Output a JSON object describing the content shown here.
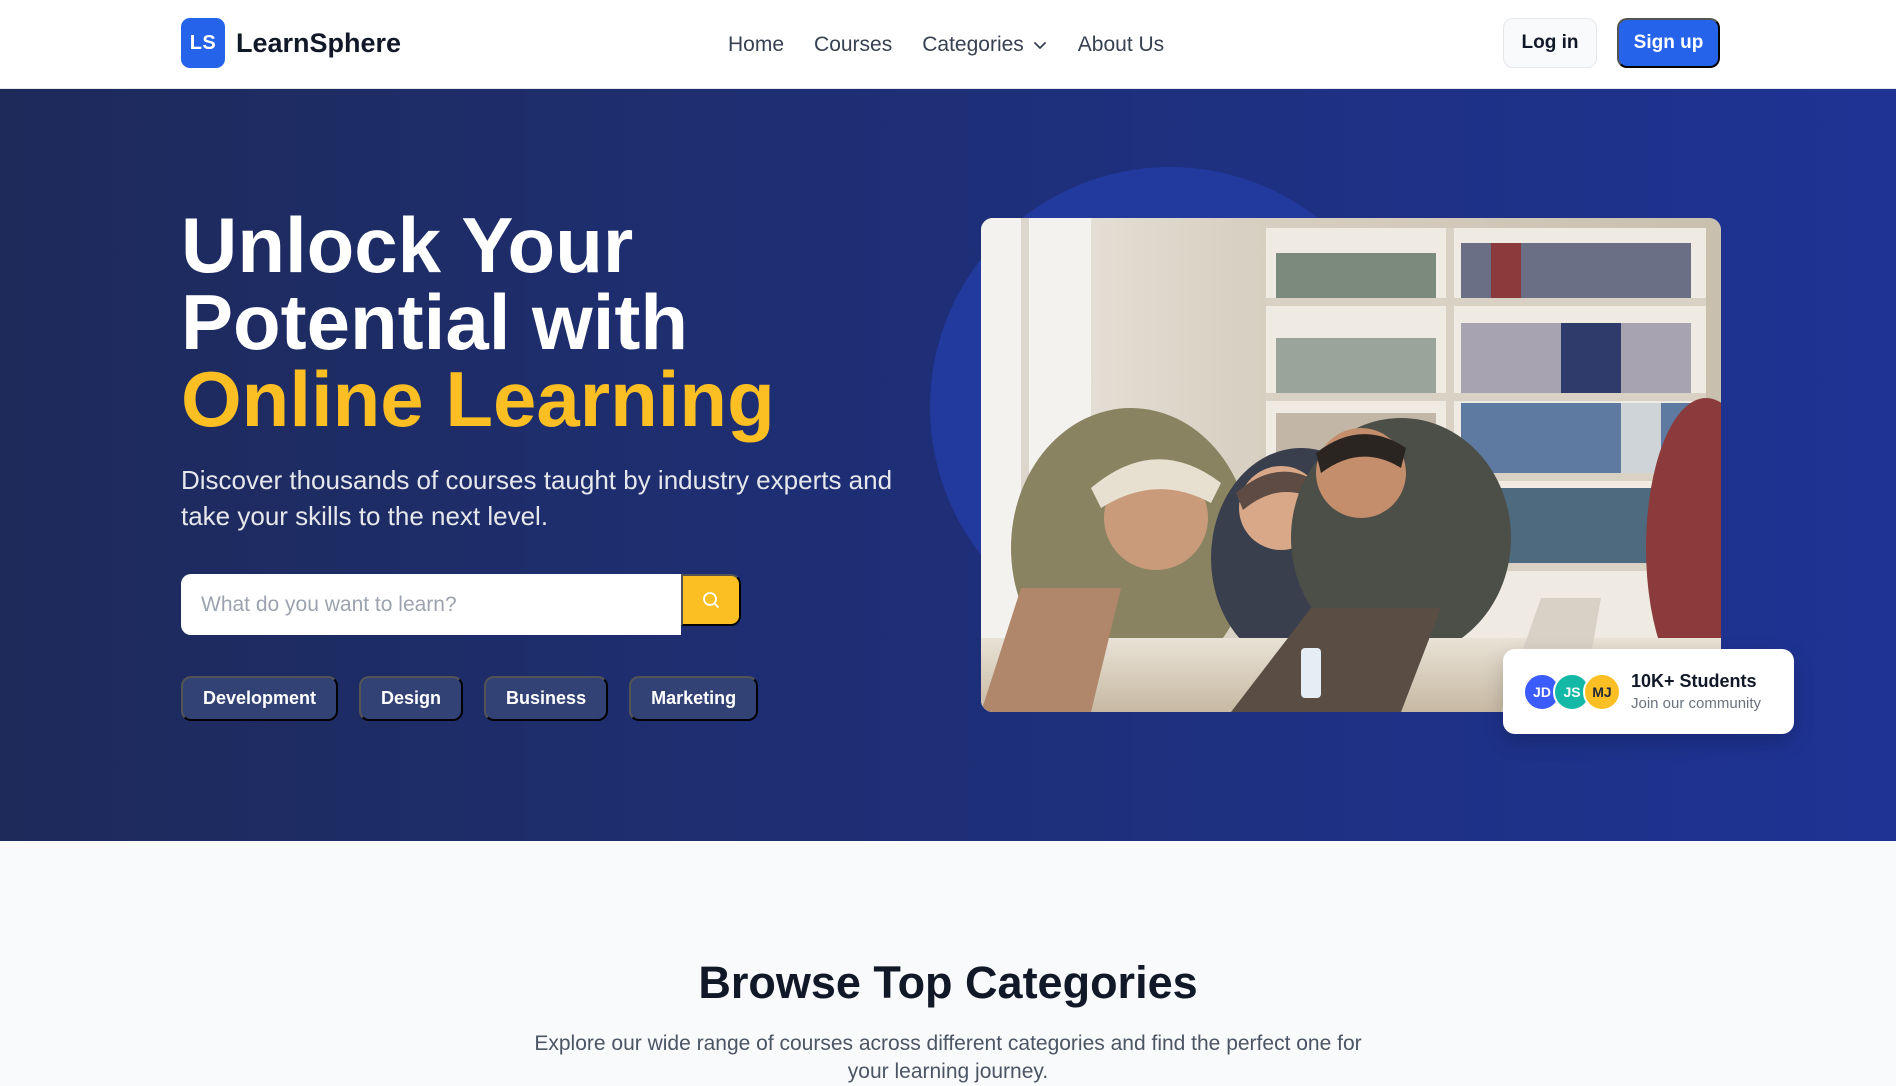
{
  "brand": {
    "logo_initials": "LS",
    "name": "LearnSphere",
    "accent_color": "#2563eb"
  },
  "nav": {
    "links": [
      {
        "label": "Home"
      },
      {
        "label": "Courses"
      },
      {
        "label": "Categories",
        "dropdown": true
      },
      {
        "label": "About Us"
      }
    ],
    "login_label": "Log in",
    "signup_label": "Sign up"
  },
  "hero": {
    "title_line1": "Unlock Your",
    "title_line2": "Potential with",
    "title_accent": "Online Learning",
    "subtitle": "Discover thousands of courses taught by industry experts and take your skills to the next level.",
    "search_placeholder": "What do you want to learn?",
    "search_icon": "search-icon",
    "chips": [
      "Development",
      "Design",
      "Business",
      "Marketing"
    ],
    "accent_color": "#fbbf24",
    "stats": {
      "avatars": [
        {
          "initials": "JD",
          "color": "#3b5bfd"
        },
        {
          "initials": "JS",
          "color": "#14b8a6"
        },
        {
          "initials": "MJ",
          "color": "#fbbf24"
        }
      ],
      "title": "10K+ Students",
      "subtitle": "Join our community"
    }
  },
  "categories": {
    "title": "Browse Top Categories",
    "subtitle": "Explore our wide range of courses across different categories and find the perfect one for your learning journey."
  }
}
